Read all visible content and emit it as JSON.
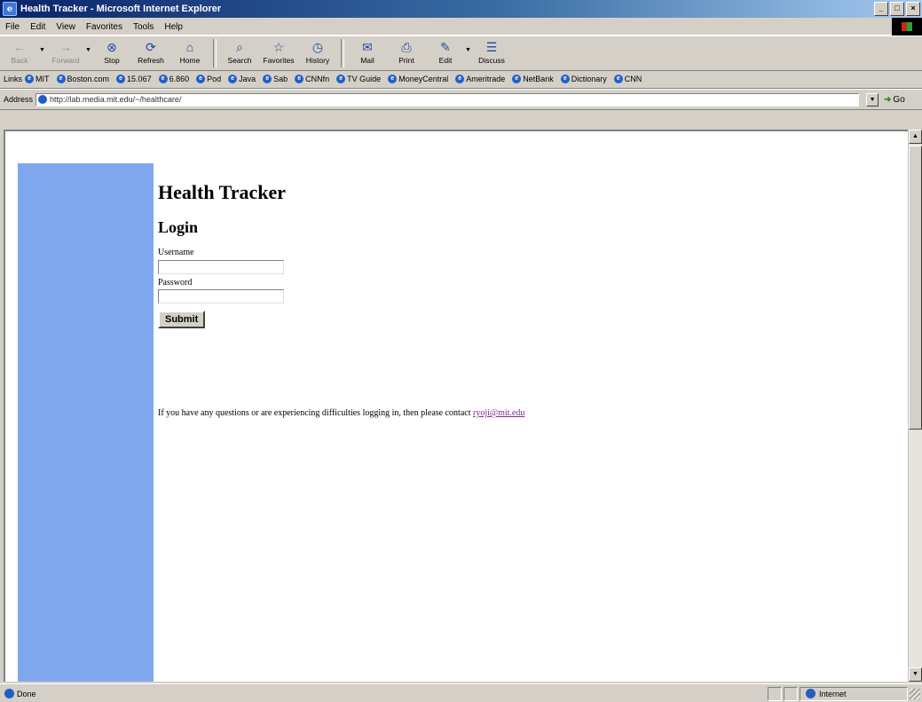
{
  "window": {
    "title": "Health Tracker - Microsoft Internet Explorer",
    "app_icon_letter": "e",
    "controls": {
      "minimize": "_",
      "maximize": "□",
      "close": "×"
    }
  },
  "menu": [
    "File",
    "Edit",
    "View",
    "Favorites",
    "Tools",
    "Help"
  ],
  "toolbar": {
    "back": {
      "label": "Back",
      "icon": "←"
    },
    "forward": {
      "label": "Forward",
      "icon": "→"
    },
    "stop": {
      "label": "Stop",
      "icon": "⊗"
    },
    "refresh": {
      "label": "Refresh",
      "icon": "⟳"
    },
    "home": {
      "label": "Home",
      "icon": "⌂"
    },
    "search": {
      "label": "Search",
      "icon": "⌕"
    },
    "favorites": {
      "label": "Favorites",
      "icon": "☆"
    },
    "history": {
      "label": "History",
      "icon": "◷"
    },
    "mail": {
      "label": "Mail",
      "icon": "✉"
    },
    "print": {
      "label": "Print",
      "icon": "⎙"
    },
    "edit": {
      "label": "Edit",
      "icon": "✎"
    },
    "discuss": {
      "label": "Discuss",
      "icon": "☰"
    }
  },
  "links_bar": {
    "label": "Links",
    "items": [
      "MIT",
      "Boston.com",
      "15.067",
      "6.860",
      "Pod",
      "Java",
      "Sab",
      "CNNfn",
      "TV Guide",
      "MoneyCentral",
      "Ameritrade",
      "NetBank",
      "Dictionary",
      "CNN"
    ]
  },
  "address_bar": {
    "label": "Address",
    "url": "http://lab.media.mit.edu/~/healthcare/",
    "go_label": "Go"
  },
  "page": {
    "title": "Health Tracker",
    "login_heading": "Login",
    "username_label": "Username",
    "password_label": "Password",
    "submit_label": "Submit",
    "contact_text": "If you have any questions or are experiencing difficulties logging in, then please contact",
    "contact_link": "ryoji@mit.edu"
  },
  "status_bar": {
    "status": "Done",
    "zone": "Internet"
  }
}
